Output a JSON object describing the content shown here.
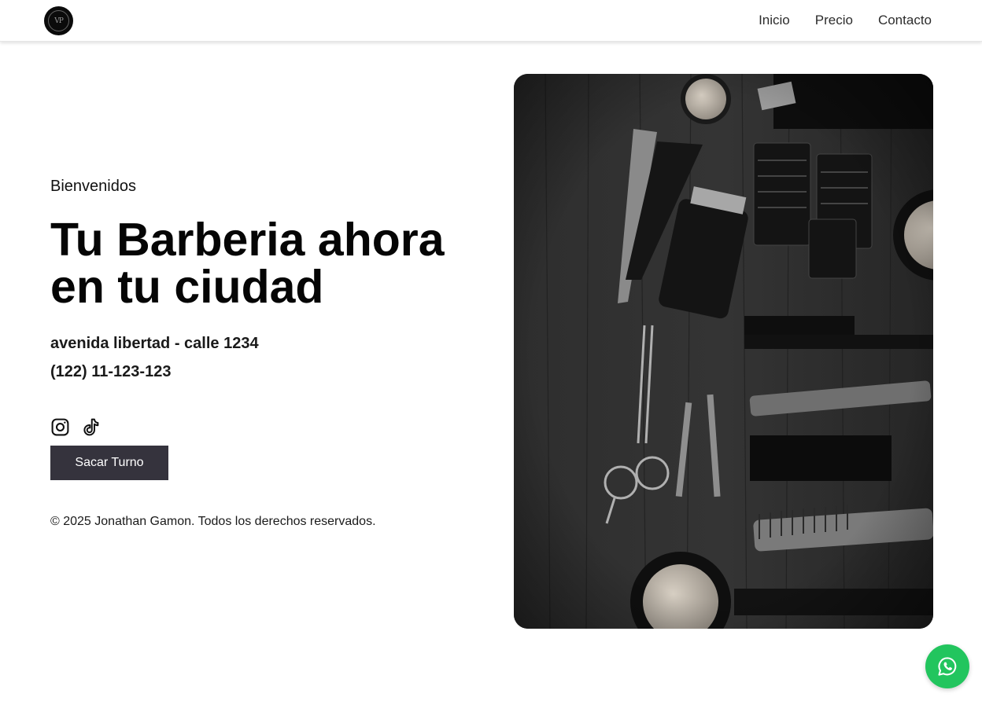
{
  "header": {
    "logo_text": "VP",
    "nav": [
      {
        "label": "Inicio"
      },
      {
        "label": "Precio"
      },
      {
        "label": "Contacto"
      }
    ]
  },
  "hero": {
    "welcome": "Bienvenidos",
    "headline_line1": "Tu Barberia ahora",
    "headline_line2": "en tu ciudad",
    "address": "avenida libertad - calle 1234",
    "phone": "(122) 11-123-123",
    "socials": [
      {
        "icon": "instagram-icon"
      },
      {
        "icon": "tiktok-icon"
      }
    ],
    "cta_label": "Sacar Turno",
    "copyright": "© 2025 Jonathan Gamon. Todos los derechos reservados."
  },
  "image": {
    "subject": "barber tools on dark wood",
    "alt": ""
  },
  "floating": {
    "whatsapp_icon": "whatsapp-icon",
    "color": "#22c55e"
  },
  "colors": {
    "button_bg": "#35333d",
    "text": "#111111"
  }
}
